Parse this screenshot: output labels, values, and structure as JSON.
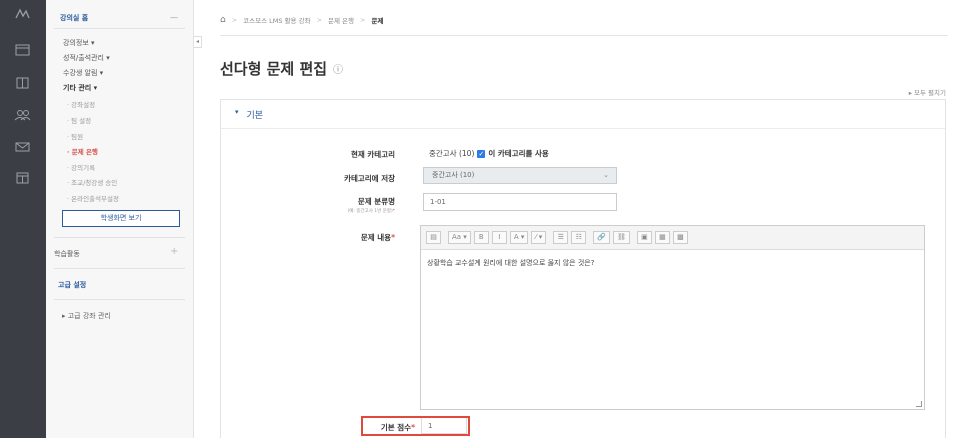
{
  "rail": {
    "icons": [
      "menu-icon",
      "window-icon",
      "book-icon",
      "users-icon",
      "mail-icon",
      "calendar-icon"
    ]
  },
  "sidebar": {
    "home_label": "강의실 홈",
    "dash": "—",
    "menu_items": [
      {
        "label": "강의정보 ▾"
      },
      {
        "label": "성적/출석관리 ▾"
      },
      {
        "label": "수강생 알림 ▾"
      },
      {
        "label": "기타 관리 ▾"
      }
    ],
    "sub_items": [
      {
        "label": "· 강좌설정"
      },
      {
        "label": "· 팀 설정"
      },
      {
        "label": "· 팀원"
      },
      {
        "label": "· 문제 은행"
      },
      {
        "label": "· 강의기록"
      },
      {
        "label": "· 조교/청강생 승인"
      },
      {
        "label": "· 온라인출석부설정"
      }
    ],
    "view_button": "학생화면 보기",
    "learning_label": "학습활동",
    "learning_plus": "+",
    "advanced_label": "고급 설정",
    "advanced_child": "▸ 고급 강좌 관리"
  },
  "collapse_label": "◂",
  "breadcrumb": {
    "home_icon": "⌂",
    "sep": ">",
    "items": [
      "코스모스 LMS 활용 강좌",
      "문제 은행",
      "문제"
    ]
  },
  "page": {
    "title": "선다형 문제 편집",
    "help_icon": "ⓘ",
    "expand_all": "▸ 모두 펼치기"
  },
  "section": {
    "chevron": "▾",
    "title": "기본"
  },
  "form": {
    "current_category_label": "현재 카테고리",
    "current_category_value": "중간고사 (10)",
    "use_category_checked": "✓",
    "use_category_label": "이 카테고리를 사용",
    "save_category_label": "카테고리에 저장",
    "save_category_value": "중간고사 (10)",
    "save_category_caret": "⌄",
    "question_class_label": "문제 분류명",
    "question_class_note": "(예: 중간고사 1번 문항)",
    "question_class_value": "1-01",
    "question_text_label": "문제 내용",
    "question_text_value": "상황학습 교수설계 원리에 대한 설명으로 옳지 않은 것은?",
    "required_mark": "*",
    "default_mark_label": "기본 점수",
    "default_mark_value": "1"
  },
  "toolbar": [
    "▤",
    "Aa ▾",
    "B",
    "I",
    "A ▾",
    "⁄ ▾",
    "☰",
    "☷",
    "🔗",
    "⛓",
    "▣",
    "▦",
    "▩"
  ]
}
